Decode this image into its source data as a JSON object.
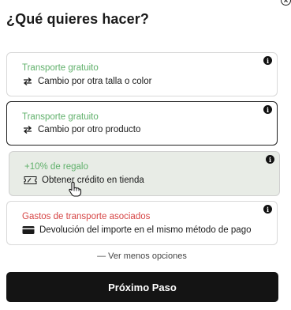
{
  "dialog": {
    "title": "¿Qué quieres hacer?",
    "close_icon": "close-circle-icon"
  },
  "options": [
    {
      "tag": "Transporte gratuito",
      "tag_color": "#5fb06a",
      "label": "Cambio por otra talla o color",
      "icon": "swap-arrows-icon",
      "info": "i",
      "state": "default"
    },
    {
      "tag": "Transporte gratuito",
      "tag_color": "#5fb06a",
      "label": "Cambio por otro producto",
      "icon": "swap-arrows-icon",
      "info": "i",
      "state": "selected"
    },
    {
      "tag": "+10% de regalo",
      "tag_color": "#5fb06a",
      "label": "Obtener crédito en tienda",
      "icon": "voucher-ticket-icon",
      "info": "i",
      "state": "hover"
    },
    {
      "tag": "Gastos de transporte asociados",
      "tag_color": "#d64545",
      "label": "Devolución del importe en el mismo método de pago",
      "icon": "credit-card-icon",
      "info": "i",
      "state": "default"
    }
  ],
  "show_fewer": "— Ver menos opciones",
  "next_button": "Próximo Paso",
  "colors": {
    "accent_green": "#5fb06a",
    "accent_red": "#d64545",
    "cta_bg": "#141414",
    "hover_bg": "#e8ece6"
  }
}
